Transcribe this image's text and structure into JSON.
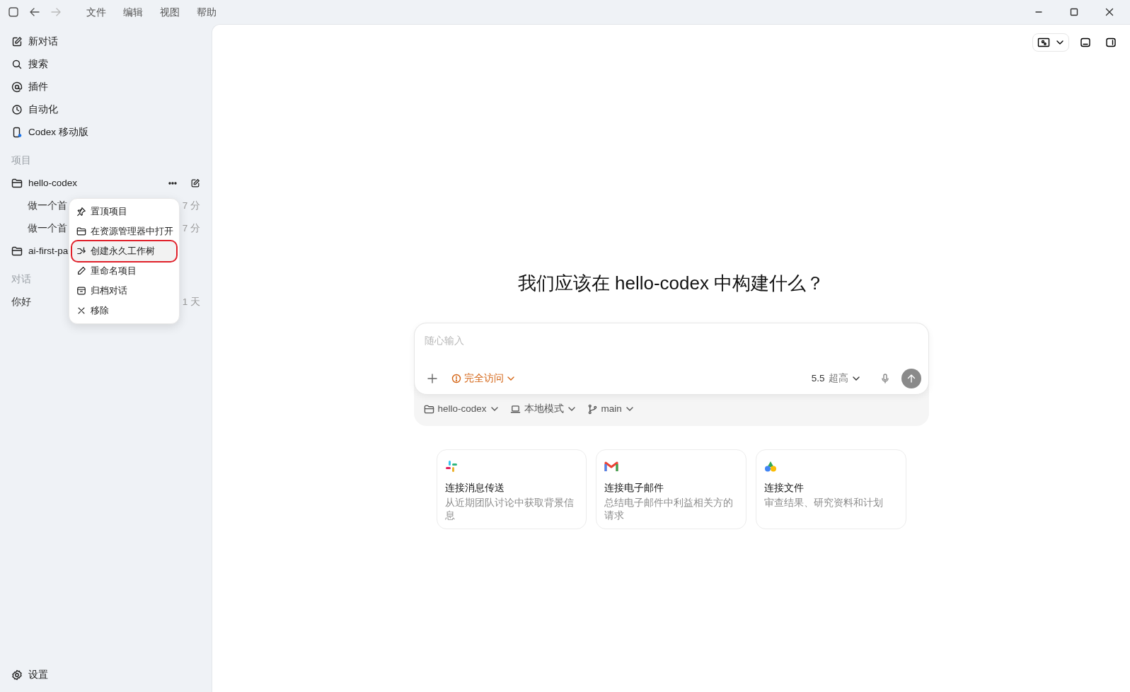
{
  "title_bar": {
    "nav": [
      {
        "kind": "sidebar",
        "disabled": false
      },
      {
        "kind": "back",
        "disabled": false
      },
      {
        "kind": "forward",
        "disabled": true
      }
    ],
    "menus": [
      "文件",
      "编辑",
      "视图",
      "帮助"
    ]
  },
  "sidebar": {
    "items": [
      {
        "label": "新对话"
      },
      {
        "label": "搜索"
      },
      {
        "label": "插件"
      },
      {
        "label": "自动化"
      },
      {
        "label": "Codex 移动版"
      }
    ],
    "projects_heading": "项目",
    "projects": [
      {
        "name": "hello-codex",
        "threads": [
          {
            "title": "做一个首",
            "time": "7 分"
          },
          {
            "title": "做一个首",
            "time": "7 分"
          }
        ]
      },
      {
        "name": "ai-first-pa"
      }
    ],
    "chats_heading": "对话",
    "chats": [
      {
        "title": "你好",
        "time": "1 天"
      }
    ],
    "settings": "设置"
  },
  "context_menu": {
    "items": [
      {
        "label": "置顶项目",
        "selected": false,
        "outlined": false
      },
      {
        "label": "在资源管理器中打开",
        "selected": false,
        "outlined": false
      },
      {
        "label": "创建永久工作树",
        "selected": true,
        "outlined": true
      },
      {
        "label": "重命名项目",
        "selected": false,
        "outlined": false
      },
      {
        "label": "归档对话",
        "selected": false,
        "outlined": false
      },
      {
        "label": "移除",
        "selected": false,
        "outlined": false
      }
    ]
  },
  "main": {
    "heading": "我们应该在 hello-codex 中构建什么？",
    "composer": {
      "placeholder": "随心输入",
      "access": "完全访问",
      "model": "5.5",
      "effort": "超高"
    },
    "context_chips": [
      "hello-codex",
      "本地模式",
      "main"
    ],
    "cards": [
      {
        "title": "连接消息传送",
        "description": "从近期团队讨论中获取背景信息"
      },
      {
        "title": "连接电子邮件",
        "description": "总结电子邮件中利益相关方的请求"
      },
      {
        "title": "连接文件",
        "description": "审查结果、研究资料和计划"
      }
    ]
  }
}
